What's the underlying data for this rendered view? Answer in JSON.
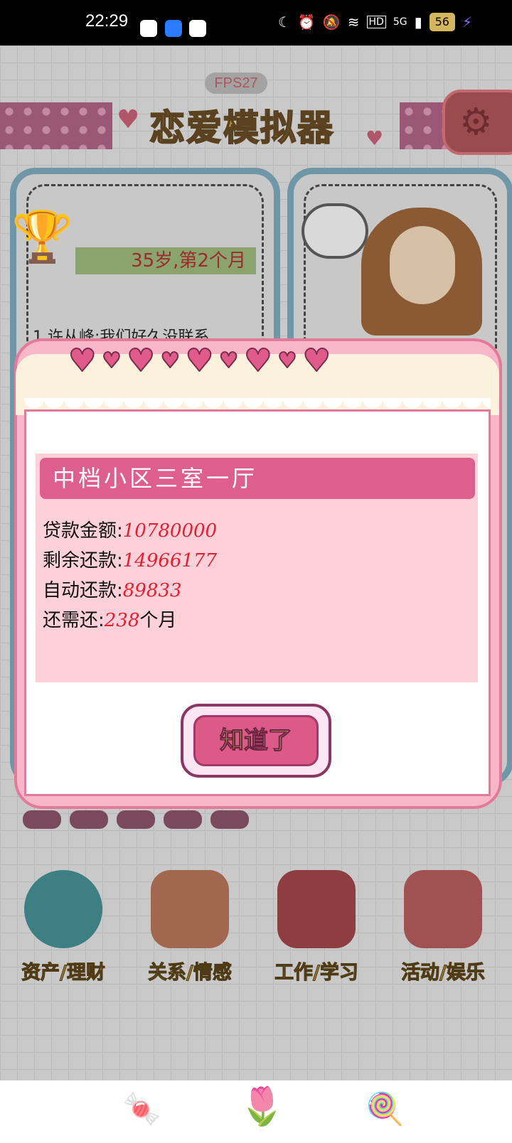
{
  "status_bar": {
    "time": "22:29",
    "network": "5G",
    "hd": "HD",
    "battery": "56",
    "icons": [
      "moon-icon",
      "alarm-icon",
      "mute-icon",
      "wifi-icon",
      "signal-icon",
      "charging-icon"
    ]
  },
  "game": {
    "fps": "FPS27",
    "title": "恋爱模拟器",
    "age_text": "35岁,第2个月",
    "message_peek": "1.许从峰:我们好久没联系",
    "menu": [
      {
        "label": "资产/理财",
        "icon": "piggy-bank-icon"
      },
      {
        "label": "关系/情感",
        "icon": "couple-cups-icon"
      },
      {
        "label": "工作/学习",
        "icon": "notebook-icon"
      },
      {
        "label": "活动/娱乐",
        "icon": "popcorn-icon"
      }
    ]
  },
  "dialog": {
    "title": "中档小区三室一厅",
    "rows": [
      {
        "label": "贷款金额:",
        "value": "10780000",
        "suffix": ""
      },
      {
        "label": "剩余还款:",
        "value": "14966177",
        "suffix": ""
      },
      {
        "label": "自动还款:",
        "value": "89833",
        "suffix": ""
      },
      {
        "label": "还需还:",
        "value": "238",
        "suffix": "个月"
      }
    ],
    "confirm_label": "知道了"
  },
  "nav": {
    "icons": [
      "candy-icon",
      "flower-icon",
      "lollipop-icon"
    ]
  }
}
